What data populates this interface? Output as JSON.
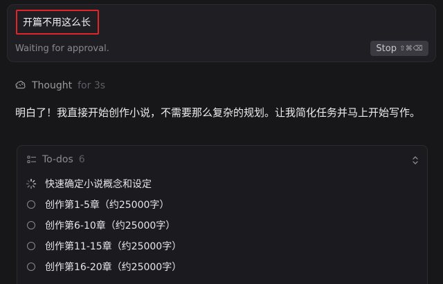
{
  "message": {
    "user_text": "开篇不用这么长",
    "status": "Waiting for approval.",
    "stop_label": "Stop",
    "stop_shortcut": "⇧⌘⌫"
  },
  "thought": {
    "label": "Thought",
    "duration": "for 3s"
  },
  "assistant": {
    "text": "明白了！我直接开始创作小说，不需要那么复杂的规划。让我简化任务并马上开始写作。"
  },
  "todos": {
    "title": "To-dos",
    "count": "6",
    "items": [
      {
        "label": "快速确定小说概念和设定",
        "state": "in-progress"
      },
      {
        "label": "创作第1-5章（约25000字）",
        "state": "pending"
      },
      {
        "label": "创作第6-10章（约25000字）",
        "state": "pending"
      },
      {
        "label": "创作第11-15章（约25000字）",
        "state": "pending"
      },
      {
        "label": "创作第16-20章（约25000字）",
        "state": "pending"
      }
    ]
  },
  "colors": {
    "background": "#17171a",
    "card": "#1f1f23",
    "highlight_border": "#e0262a",
    "muted_text": "#8a8a90"
  },
  "icons": [
    "brain-icon",
    "list-icon",
    "collapse-icon",
    "spinner-icon",
    "circle-icon"
  ]
}
